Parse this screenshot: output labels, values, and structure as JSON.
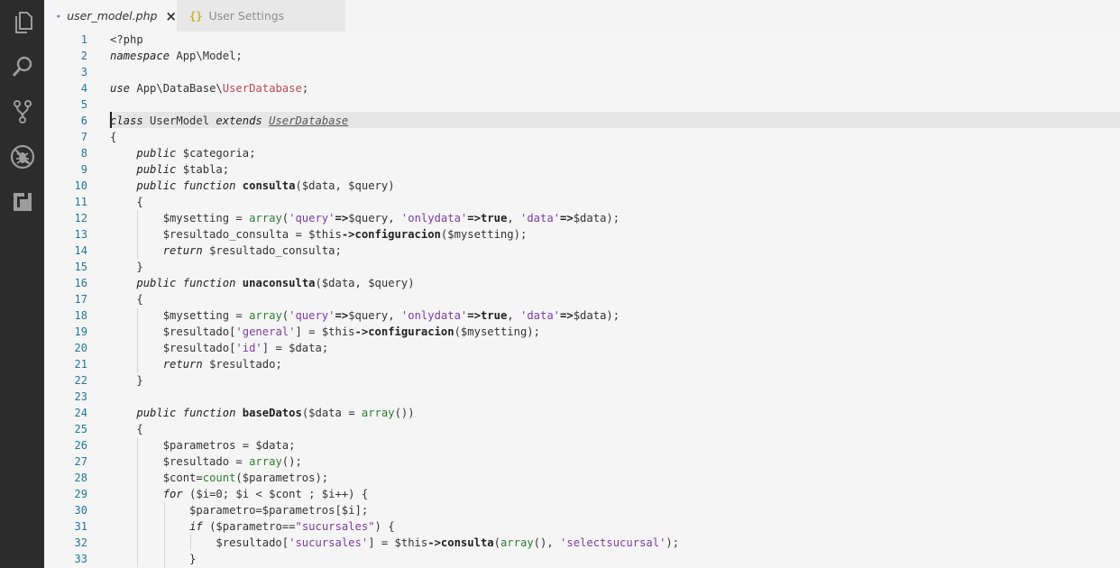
{
  "activity_bar": {
    "icons": [
      "explorer-icon",
      "search-icon",
      "source-control-icon",
      "debug-icon",
      "extensions-icon"
    ]
  },
  "tabs": [
    {
      "label": "user_model.php",
      "active": true,
      "icon": "php-file-icon"
    },
    {
      "label": "User Settings",
      "active": false,
      "icon": "json-braces-icon"
    }
  ],
  "editor": {
    "line_numbers": [
      "1",
      "2",
      "3",
      "4",
      "5",
      "6",
      "7",
      "8",
      "9",
      "10",
      "11",
      "12",
      "13",
      "14",
      "15",
      "16",
      "17",
      "18",
      "19",
      "20",
      "21",
      "22",
      "23",
      "24",
      "25",
      "26",
      "27",
      "28",
      "29",
      "30",
      "31",
      "32",
      "33"
    ],
    "current_line": 6,
    "lines": [
      "<?php",
      "namespace App\\Model;",
      "",
      "use App\\DataBase\\UserDatabase;",
      "",
      "class UserModel extends UserDatabase",
      "{",
      "    public $categoria;",
      "    public $tabla;",
      "    public function consulta($data, $query)",
      "    {",
      "        $mysetting = array('query'=>$query, 'onlydata'=>true, 'data'=>$data);",
      "        $resultado_consulta = $this->configuracion($mysetting);",
      "        return $resultado_consulta;",
      "    }",
      "    public function unaconsulta($data, $query)",
      "    {",
      "        $mysetting = array('query'=>$query, 'onlydata'=>true, 'data'=>$data);",
      "        $resultado['general'] = $this->configuracion($mysetting);",
      "        $resultado['id'] = $data;",
      "        return $resultado;",
      "    }",
      "",
      "    public function baseDatos($data = array())",
      "    {",
      "        $parametros = $data;",
      "        $resultado = array();",
      "        $cont=count($parametros);",
      "        for ($i=0; $i < $cont ; $i++) {",
      "            $parametro=$parametros[$i];",
      "            if ($parametro==\"sucursales\") {",
      "                $resultado['sucursales'] = $this->consulta(array(), 'selectsucursal');",
      "            }"
    ]
  }
}
